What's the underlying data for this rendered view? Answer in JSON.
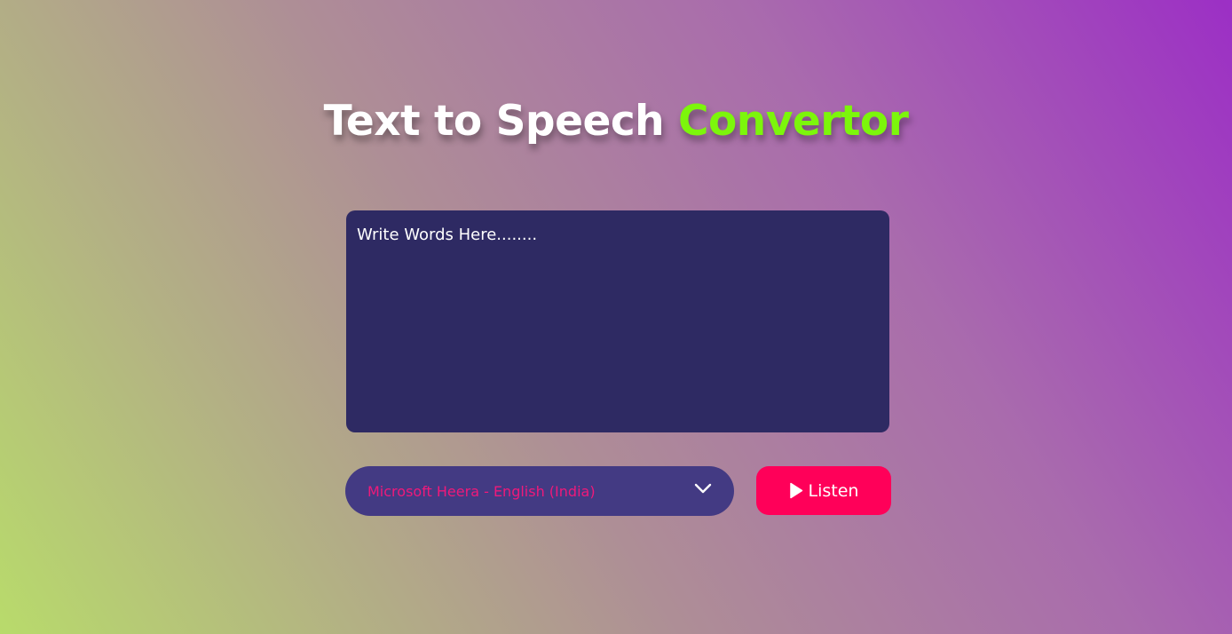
{
  "header": {
    "title_main": "Text to Speech",
    "title_accent": "Convertor"
  },
  "editor": {
    "value": "",
    "placeholder": "Write Words Here........"
  },
  "voice": {
    "selected": "Microsoft Heera - English (India)",
    "icon": "chevron-down-icon"
  },
  "actions": {
    "listen_label": "Listen",
    "listen_icon": "play-icon"
  },
  "colors": {
    "title_accent": "#7cf60b",
    "textarea_bg": "#2e2a63",
    "select_bg": "#433a83",
    "select_text": "#f0197a",
    "button_bg": "#ff0059"
  }
}
